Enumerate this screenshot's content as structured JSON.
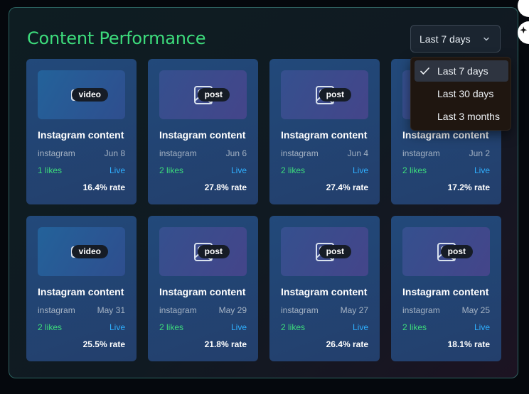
{
  "header": {
    "title": "Content Performance"
  },
  "filter": {
    "selected_label": "Last 7 days",
    "options": [
      {
        "label": "Last 7 days",
        "selected": true
      },
      {
        "label": "Last 30 days",
        "selected": false
      },
      {
        "label": "Last 3 months",
        "selected": false
      }
    ]
  },
  "colors": {
    "title": "#3ddc7c",
    "likes": "#3ddc7c",
    "status": "#2fb0ff",
    "card_bg": "#234679"
  },
  "cards": [
    {
      "type": "video",
      "icon": "video-camera-icon",
      "title": "Instagram content",
      "platform": "instagram",
      "date": "Jun 8",
      "likes": "1 likes",
      "status": "Live",
      "rate": "16.4% rate"
    },
    {
      "type": "post",
      "icon": "image-icon",
      "title": "Instagram content",
      "platform": "instagram",
      "date": "Jun 6",
      "likes": "2 likes",
      "status": "Live",
      "rate": "27.8% rate"
    },
    {
      "type": "post",
      "icon": "image-icon",
      "title": "Instagram content",
      "platform": "instagram",
      "date": "Jun 4",
      "likes": "2 likes",
      "status": "Live",
      "rate": "27.4% rate"
    },
    {
      "type": "post",
      "icon": "image-icon",
      "title": "Instagram content",
      "platform": "instagram",
      "date": "Jun 2",
      "likes": "2 likes",
      "status": "Live",
      "rate": "17.2% rate"
    },
    {
      "type": "video",
      "icon": "video-camera-icon",
      "title": "Instagram content",
      "platform": "instagram",
      "date": "May 31",
      "likes": "2 likes",
      "status": "Live",
      "rate": "25.5% rate"
    },
    {
      "type": "post",
      "icon": "image-icon",
      "title": "Instagram content",
      "platform": "instagram",
      "date": "May 29",
      "likes": "2 likes",
      "status": "Live",
      "rate": "21.8% rate"
    },
    {
      "type": "post",
      "icon": "image-icon",
      "title": "Instagram content",
      "platform": "instagram",
      "date": "May 27",
      "likes": "2 likes",
      "status": "Live",
      "rate": "26.4% rate"
    },
    {
      "type": "post",
      "icon": "image-icon",
      "title": "Instagram content",
      "platform": "instagram",
      "date": "May 25",
      "likes": "2 likes",
      "status": "Live",
      "rate": "18.1% rate"
    }
  ]
}
